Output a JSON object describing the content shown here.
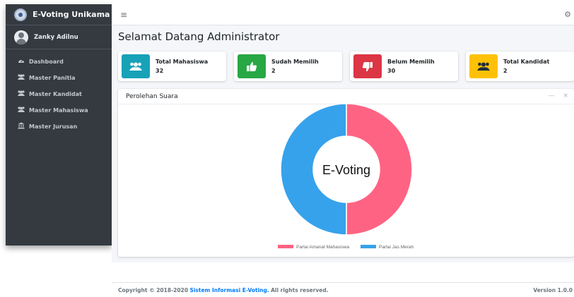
{
  "sidebar": {
    "brand": "E-Voting Unikama",
    "user_name": "Zanky Adilnu",
    "items": [
      {
        "label": "Dashboard",
        "icon": "dashboard-icon"
      },
      {
        "label": "Master Panitia",
        "icon": "users-icon"
      },
      {
        "label": "Master Kandidat",
        "icon": "users-icon"
      },
      {
        "label": "Master Mahasiswa",
        "icon": "users-icon"
      },
      {
        "label": "Master Jurusan",
        "icon": "university-icon"
      }
    ]
  },
  "topbar": {
    "menu_icon": "hamburger-icon",
    "settings_icon": "gear-icon"
  },
  "main": {
    "title": "Selamat Datang Administrator",
    "info_boxes": [
      {
        "label": "Total Mahasiswa",
        "value": "32",
        "color": "#17a2b8",
        "icon": "users-icon"
      },
      {
        "label": "Sudah Memilih",
        "value": "2",
        "color": "#28a745",
        "icon": "thumbs-up-icon"
      },
      {
        "label": "Belum Memilih",
        "value": "30",
        "color": "#dc3545",
        "icon": "thumbs-down-icon"
      },
      {
        "label": "Total Kandidat",
        "value": "2",
        "color": "#ffc107",
        "icon": "users-icon"
      }
    ],
    "card_title": "Perolehan Suara",
    "collapse_symbol": "—",
    "close_symbol": "×"
  },
  "chart_data": {
    "type": "pie",
    "center_label": "E-Voting",
    "series": [
      {
        "name": "Partai Amanat Mahasiswa",
        "value": 1,
        "color": "#ff6384"
      },
      {
        "name": "Partai Jas Merah",
        "value": 1,
        "color": "#36a2eb"
      }
    ],
    "legend_position": "bottom"
  },
  "footer": {
    "copyright_prefix": "Copyright © 2018-2020",
    "copyright_brand": "Sistem Informasi E-Voting.",
    "copyright_suffix": "All rights reserved.",
    "version": "Version 1.0.0"
  }
}
